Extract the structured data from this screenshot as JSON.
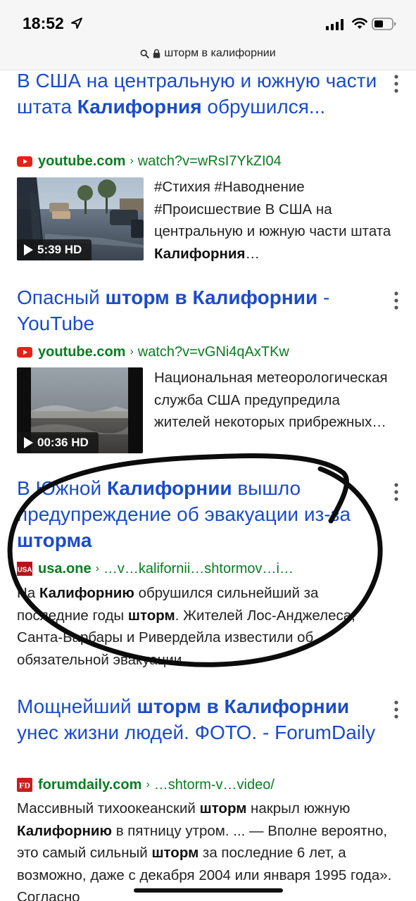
{
  "status": {
    "time": "18:52"
  },
  "url": {
    "query": "шторм в калифорнии"
  },
  "results": [
    {
      "title_segments": [
        {
          "text": "В США на центральную и южную части штата ",
          "bold": false
        },
        {
          "text": "Калифорния",
          "bold": true
        },
        {
          "text": " обрушился...",
          "bold": false
        }
      ],
      "site": "youtube.com",
      "path": "watch?v=wRsI7YkZI04",
      "duration": "5:39 HD",
      "snippet_segments": [
        {
          "text": "#Стихия #Наводнение #Происшествие В США на центральную и южную части штата ",
          "bold": false
        },
        {
          "text": "Калифорния",
          "bold": true
        },
        {
          "text": "…",
          "bold": false
        }
      ]
    },
    {
      "title_segments": [
        {
          "text": "Опасный ",
          "bold": false
        },
        {
          "text": "шторм в Калифорнии",
          "bold": true
        },
        {
          "text": " - YouTube",
          "bold": false
        }
      ],
      "site": "youtube.com",
      "path": "watch?v=vGNi4qAxTKw",
      "duration": "00:36 HD",
      "snippet_segments": [
        {
          "text": "Национальная метеорологическая служба США предупредила жителей некоторых прибрежных…",
          "bold": false
        }
      ]
    },
    {
      "title_segments": [
        {
          "text": "В Южной ",
          "bold": false
        },
        {
          "text": "Калифорнии",
          "bold": true
        },
        {
          "text": " вышло предупреждение об эвакуации из-за ",
          "bold": false
        },
        {
          "text": "шторма",
          "bold": true
        }
      ],
      "site": "usa.one",
      "path": "…v…kalifornii…shtormov…i…",
      "logo_text": "USA",
      "snippet_segments": [
        {
          "text": "На ",
          "bold": false
        },
        {
          "text": "Калифорнию",
          "bold": true
        },
        {
          "text": " обрушился сильнейший за последние годы ",
          "bold": false
        },
        {
          "text": "шторм",
          "bold": true
        },
        {
          "text": ". Жителей Лос-Анджелеса, Санта-Барбары и Ривердейла известили об обязательной эвакуации.",
          "bold": false
        }
      ]
    },
    {
      "title_segments": [
        {
          "text": "Мощнейший ",
          "bold": false
        },
        {
          "text": "шторм в Калифорнии",
          "bold": true
        },
        {
          "text": " унес жизни людей. ФОТО. - ForumDaily",
          "bold": false
        }
      ],
      "site": "forumdaily.com",
      "path": "…shtorm-v…video/",
      "logo_text": "FD",
      "snippet_segments": [
        {
          "text": "Массивный тихоокеанский ",
          "bold": false
        },
        {
          "text": "шторм",
          "bold": true
        },
        {
          "text": " накрыл южную ",
          "bold": false
        },
        {
          "text": "Калифорнию",
          "bold": true
        },
        {
          "text": " в пятницу утром. ... — Вполне вероятно, это самый сильный ",
          "bold": false
        },
        {
          "text": "шторм",
          "bold": true
        },
        {
          "text": " за последние 6 лет, а возможно, даже с декабря 2004 или января 1995 года». Согласно",
          "bold": false
        }
      ]
    }
  ],
  "colors": {
    "link": "#1a4cc9",
    "url_green": "#0a7d20",
    "youtube_red": "#e62117",
    "usa_red": "#b3141a",
    "forumdaily_red": "#c81e1e"
  }
}
